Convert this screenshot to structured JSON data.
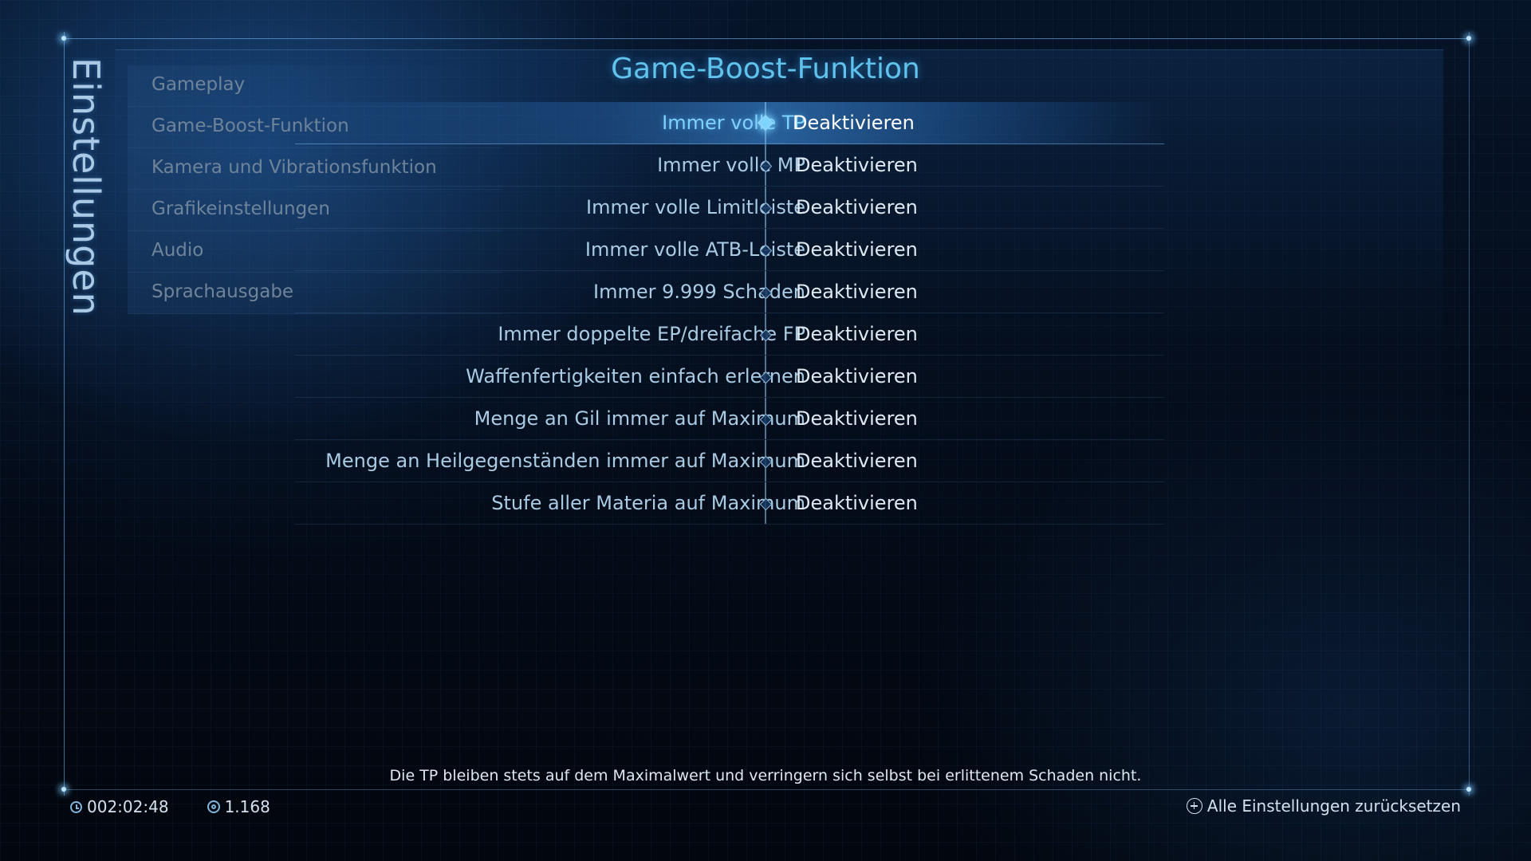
{
  "side_title": "Einstellungen",
  "page_title": "Game-Boost-Funktion",
  "categories": [
    {
      "label": "Gameplay"
    },
    {
      "label": "Game-Boost-Funktion"
    },
    {
      "label": "Kamera und Vibrationsfunktion"
    },
    {
      "label": "Grafikeinstellungen"
    },
    {
      "label": "Audio"
    },
    {
      "label": "Sprachausgabe"
    }
  ],
  "options": [
    {
      "label": "Immer volle TP",
      "value": "Deaktivieren",
      "selected": true
    },
    {
      "label": "Immer volle MP",
      "value": "Deaktivieren"
    },
    {
      "label": "Immer volle Limitleiste",
      "value": "Deaktivieren"
    },
    {
      "label": "Immer volle ATB-Leiste",
      "value": "Deaktivieren"
    },
    {
      "label": "Immer 9.999 Schaden",
      "value": "Deaktivieren"
    },
    {
      "label": "Immer doppelte EP/dreifache FP",
      "value": "Deaktivieren"
    },
    {
      "label": "Waffenfertigkeiten einfach erlernen",
      "value": "Deaktivieren"
    },
    {
      "label": "Menge an Gil immer auf Maximum",
      "value": "Deaktivieren"
    },
    {
      "label": "Menge an Heilgegenständen immer auf Maximum",
      "value": "Deaktivieren"
    },
    {
      "label": "Stufe aller Materia auf Maximum",
      "value": "Deaktivieren"
    }
  ],
  "description": "Die TP bleiben stets auf dem Maximalwert und verringern sich selbst bei erlittenem Schaden nicht.",
  "footer": {
    "playtime": "002:02:48",
    "playtime_icon": "clock-icon",
    "gil": "1.168",
    "gil_icon": "gil-icon",
    "reset_label": "Alle Einstellungen zurücksetzen",
    "reset_icon": "plus-circle-icon"
  },
  "colors": {
    "accent": "#5fc3ee",
    "selected_row": "#3c8cdc",
    "label_text": "#a9cbe3",
    "value_text": "#dfe9f2"
  }
}
